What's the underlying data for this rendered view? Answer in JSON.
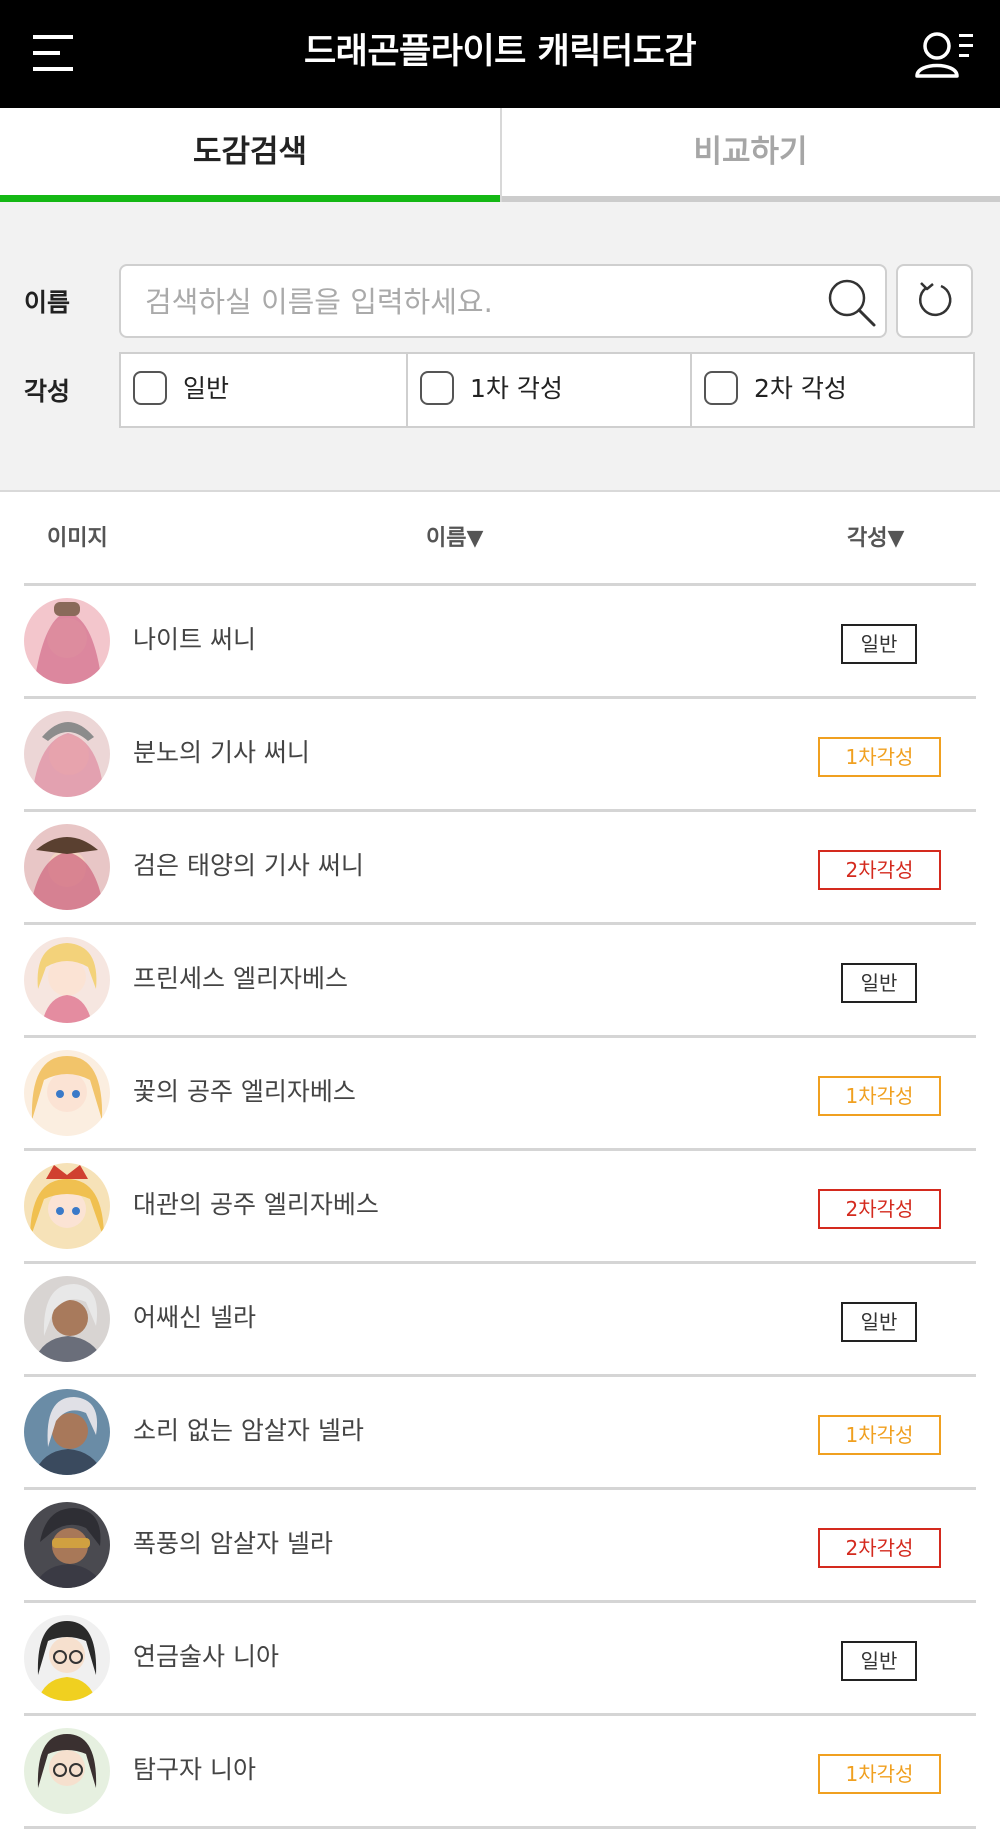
{
  "header": {
    "title": "드래곤플라이트 캐릭터도감",
    "menu_icon": "hamburger-menu-icon",
    "user_icon": "user-list-icon"
  },
  "tabs": [
    {
      "label": "도감검색",
      "active": true
    },
    {
      "label": "비교하기",
      "active": false
    }
  ],
  "filter": {
    "name_label": "이름",
    "search_placeholder": "검색하실 이름을 입력하세요.",
    "awakening_label": "각성",
    "options": [
      {
        "label": "일반"
      },
      {
        "label": "1차 각성"
      },
      {
        "label": "2차 각성"
      }
    ]
  },
  "list_header": {
    "image": "이미지",
    "name": "이름▼",
    "awakening": "각성▼"
  },
  "colors": {
    "accent_green": "#14b814",
    "badge_general": "#222222",
    "badge_first": "#f0a020",
    "badge_second": "#d42a1e"
  },
  "rows": [
    {
      "name": "나이트 써니",
      "badge": "일반",
      "level": 0
    },
    {
      "name": "분노의 기사 써니",
      "badge": "1차각성",
      "level": 1
    },
    {
      "name": "검은 태양의 기사 써니",
      "badge": "2차각성",
      "level": 2
    },
    {
      "name": "프린세스 엘리자베스",
      "badge": "일반",
      "level": 0
    },
    {
      "name": "꽃의 공주 엘리자베스",
      "badge": "1차각성",
      "level": 1
    },
    {
      "name": "대관의 공주 엘리자베스",
      "badge": "2차각성",
      "level": 2
    },
    {
      "name": "어쌔신 넬라",
      "badge": "일반",
      "level": 0
    },
    {
      "name": "소리 없는 암살자 넬라",
      "badge": "1차각성",
      "level": 1
    },
    {
      "name": "폭풍의 암살자 넬라",
      "badge": "2차각성",
      "level": 2
    },
    {
      "name": "연금술사 니아",
      "badge": "일반",
      "level": 0
    },
    {
      "name": "탐구자 니아",
      "badge": "1차각성",
      "level": 1
    }
  ]
}
